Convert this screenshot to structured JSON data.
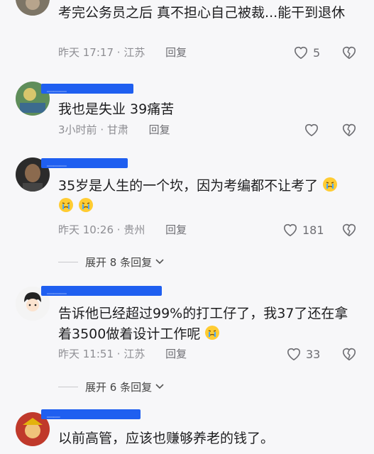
{
  "comments": [
    {
      "text": "考完公务员之后 真不担心自己被裁...能干到退休",
      "time": "昨天 17:17",
      "location": "江苏",
      "reply": "回复",
      "likes": "5"
    },
    {
      "text": "我也是失业   39痛苦",
      "time": "3小时前",
      "location": "甘肃",
      "reply": "回复",
      "likes": ""
    },
    {
      "text": "35岁是人生的一个坎，因为考编都不让考了",
      "time": "昨天 10:26",
      "location": "贵州",
      "reply": "回复",
      "likes": "181",
      "expand": "展开 8 条回复"
    },
    {
      "text": "告诉他已经超过99%的打工仔了，我37了还在拿着3500做着设计工作呢",
      "time": "昨天 11:51",
      "location": "江苏",
      "reply": "回复",
      "likes": "33",
      "expand": "展开 6 条回复"
    },
    {
      "text": "以前高管，应该也赚够养老的钱了。"
    }
  ],
  "separator": " · "
}
